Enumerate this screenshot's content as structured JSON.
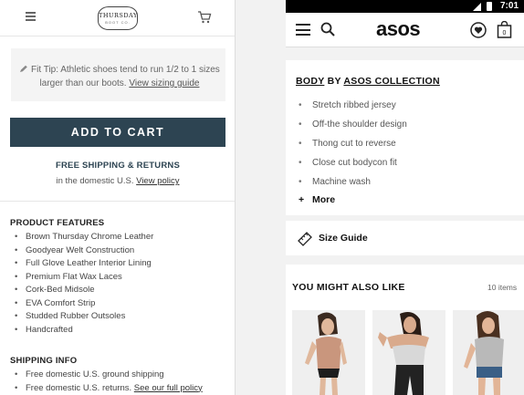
{
  "left_panel": {
    "logo": {
      "line1": "THURSDAY",
      "line2": "BOOT CO."
    },
    "fit_tip": {
      "text": "Fit Tip: Athletic shoes tend to run 1/2 to 1 sizes larger than our boots.",
      "link": "View sizing guide"
    },
    "add_to_cart_label": "ADD TO CART",
    "shipping": {
      "title": "FREE SHIPPING & RETURNS",
      "text": "in the domestic U.S.",
      "link": "View policy"
    },
    "product_features": {
      "title": "PRODUCT FEATURES",
      "items": [
        "Brown Thursday Chrome Leather",
        "Goodyear Welt Construction",
        "Full Glove Leather Interior Lining",
        "Premium Flat Wax Laces",
        "Cork-Bed Midsole",
        "EVA Comfort Strip",
        "Studded Rubber Outsoles",
        "Handcrafted"
      ]
    },
    "shipping_info": {
      "title": "SHIPPING INFO",
      "item1": "Free domestic U.S. ground shipping",
      "item2_text": "Free domestic U.S. returns.",
      "item2_link": "See our full policy"
    }
  },
  "right_panel": {
    "status_time": "7:01",
    "brand_logo": "asos",
    "product_info": {
      "prefix": "BODY",
      "by": "BY",
      "brand": "ASOS COLLECTION"
    },
    "details": [
      "Stretch ribbed jersey",
      "Off-the shoulder design",
      "Thong cut to reverse",
      "Close cut bodycon fit",
      "Machine wash"
    ],
    "more_label": "More",
    "more_symbol": "+",
    "size_guide_label": "Size Guide",
    "recommendations": {
      "title": "YOU MIGHT ALSO LIKE",
      "count": "10 items"
    }
  },
  "colors": {
    "cart_button": "#2d4452",
    "statusbar": "#000000"
  },
  "icons": [
    "menu-icon",
    "cart-icon",
    "pencil-icon",
    "search-icon",
    "heart-icon",
    "bag-icon",
    "ruler-icon",
    "signal-icon",
    "battery-icon"
  ]
}
